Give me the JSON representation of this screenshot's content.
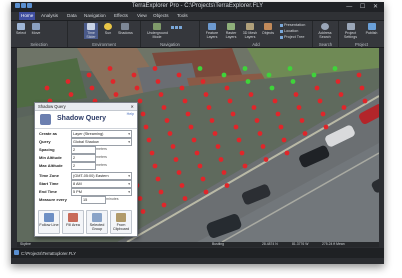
{
  "app": {
    "title": "TerraExplorer Pro - C:\\Projects\\TerraExplorer.FLY",
    "window_buttons": "— ☐ ✕"
  },
  "menu": [
    "Home",
    "Analysis",
    "Data",
    "Navigation",
    "Effects",
    "View",
    "Objects",
    "Tools"
  ],
  "ribbon": {
    "groups": {
      "selection": "Selection",
      "environment": "Environment",
      "navigation": "Navigation",
      "add": "Add",
      "search": "Search",
      "project": "Project"
    },
    "buttons": {
      "select": "Select",
      "move": "Move",
      "time_slider": "Time Slider",
      "sun": "Sun",
      "shadows": "Shadows",
      "underground_mode": "Underground Mode",
      "feature_layers": "Feature Layers",
      "raster_layers": "Raster Layers",
      "models_3d": "3D Mesh Layers",
      "objects": "Objects",
      "address_search": "Address Search",
      "project_settings": "Project Settings",
      "publish": "Publish"
    },
    "small": [
      "Presentation",
      "Location",
      "Project Tree"
    ]
  },
  "shadow_query": {
    "panel_title": "Shadow Query",
    "heading": "Shadow Query",
    "help": "Help",
    "fields": {
      "create_as": {
        "label": "Create as",
        "value": "Layer (Streaming)"
      },
      "query": {
        "label": "Query",
        "value": "Global Shadow"
      },
      "spacing": {
        "label": "Spacing",
        "value": "2",
        "unit": "meters"
      },
      "min_altitude": {
        "label": "Min Altitude",
        "value": "2",
        "unit": "meters"
      },
      "max_altitude": {
        "label": "Max Altitude",
        "value": "2",
        "unit": "meters"
      },
      "time_zone": {
        "label": "Time Zone",
        "value": "(GMT-05:00) Eastern"
      },
      "start_time": {
        "label": "Start Time",
        "value": "8 AM"
      },
      "end_time": {
        "label": "End Time",
        "value": "5 PM"
      },
      "measure_every": {
        "label": "Measure every",
        "value": "15",
        "unit": "minutes"
      }
    },
    "buttons": {
      "follow_line": "Follow Line",
      "fill_area": "Fill Area",
      "selected_group": "Selected Group",
      "from_clipboard": "From Clipboard"
    }
  },
  "status_bar": {
    "layer": "Skyline",
    "place": "Bustling",
    "lat": "28.4874 N",
    "lon": "81.3776 W",
    "alt": "275.24 ft Mean"
  },
  "path_bar": "C:\\Projects\\TerraExplorer.FLY",
  "colors": {
    "shadow_point": "#e0262a",
    "sun_point": "#3fd43a",
    "accent": "#3f4ea0"
  }
}
